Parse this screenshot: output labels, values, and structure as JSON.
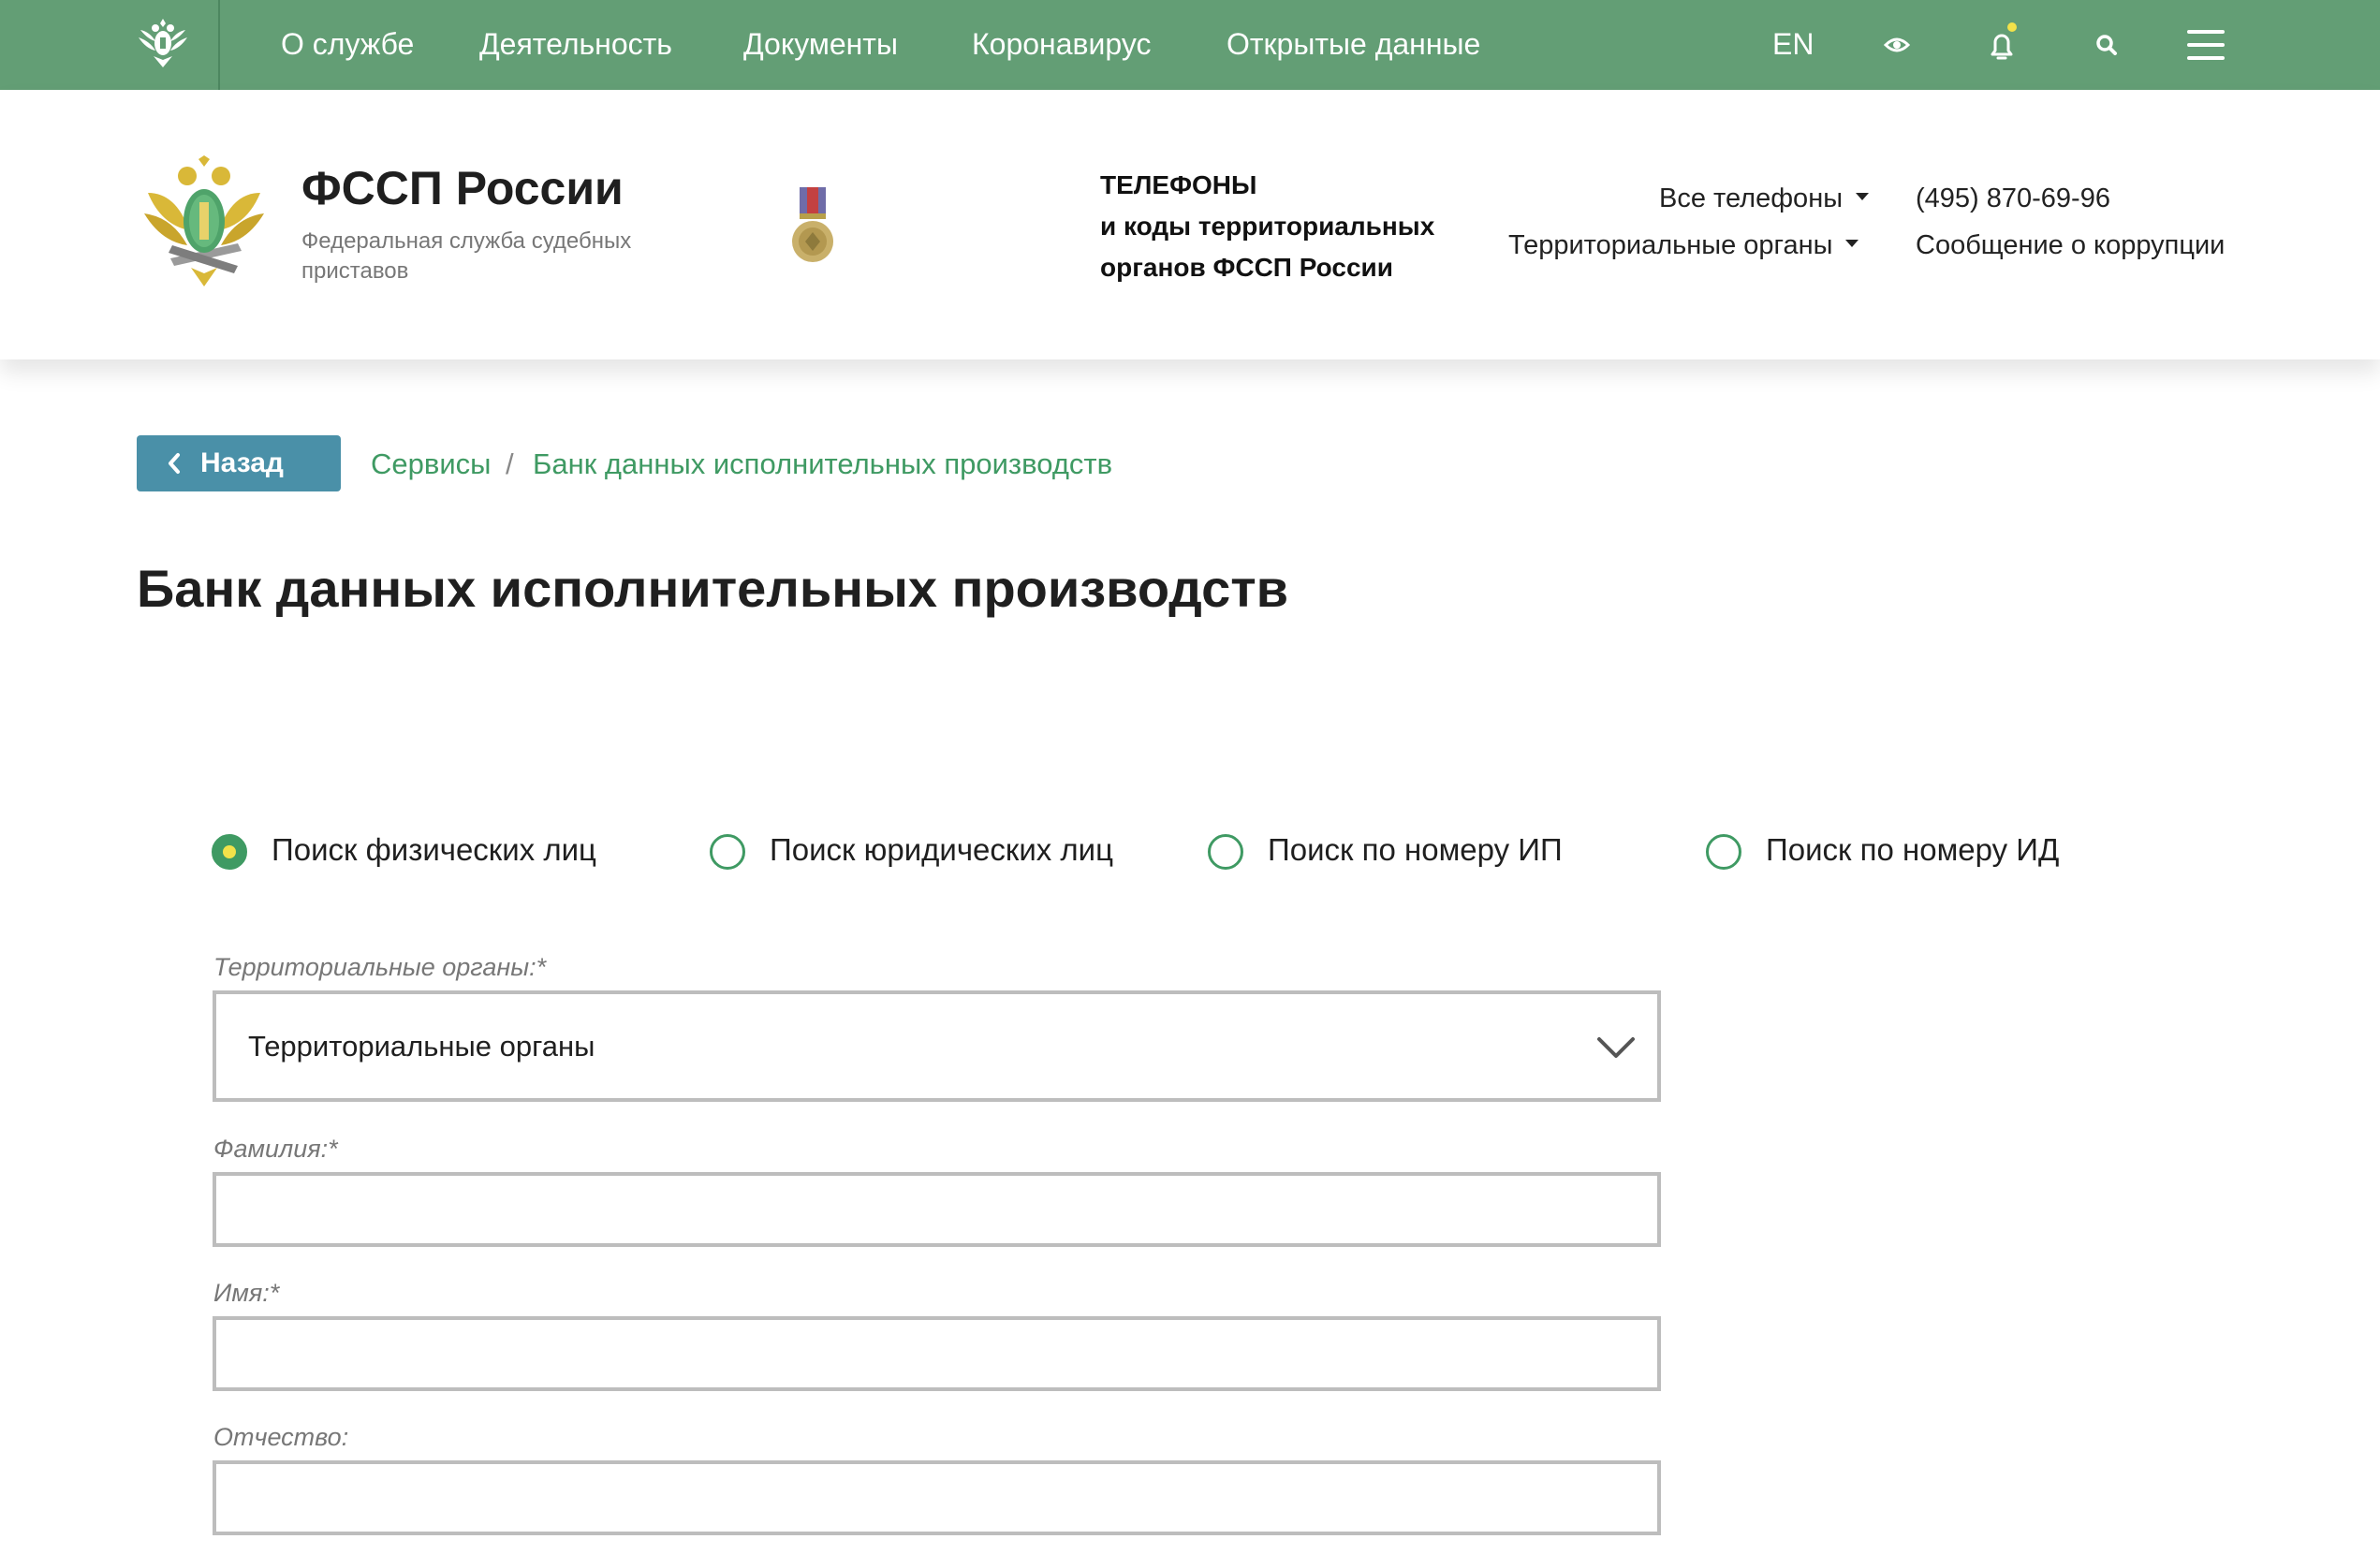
{
  "topbar": {
    "nav": [
      {
        "label": "О службе"
      },
      {
        "label": "Деятельность"
      },
      {
        "label": "Документы"
      },
      {
        "label": "Коронавирус"
      },
      {
        "label": "Открытые данные"
      }
    ],
    "lang": "EN",
    "icons": [
      "eye-icon",
      "bell-icon",
      "search-icon",
      "menu-icon"
    ],
    "notification_dot_color": "#f2e24a",
    "bg_color": "#639e75"
  },
  "header": {
    "brand_name": "ФССП России",
    "brand_sub": "Федеральная служба судебных приставов",
    "phones_line1": "ТЕЛЕФОНЫ",
    "phones_line2": "и коды территориальных",
    "phones_line3": "органов ФССП России",
    "all_phones": "Все телефоны",
    "territorial": "Территориальные органы",
    "phone": "(495) 870-69-96",
    "corruption": "Сообщение о коррупции"
  },
  "content": {
    "back_label": "Назад",
    "breadcrumb": [
      "Сервисы",
      "Банк данных исполнительных производств"
    ],
    "breadcrumb_sep": "/",
    "title": "Банк данных исполнительных производств",
    "search_modes": [
      {
        "label": "Поиск физических лиц",
        "checked": true
      },
      {
        "label": "Поиск юридических лиц",
        "checked": false
      },
      {
        "label": "Поиск по номеру ИП",
        "checked": false
      },
      {
        "label": "Поиск по номеру ИД",
        "checked": false
      }
    ],
    "form": {
      "territorial_label": "Территориальные органы:*",
      "territorial_value": "Территориальные органы",
      "lastname_label": "Фамилия:*",
      "lastname_value": "",
      "firstname_label": "Имя:*",
      "firstname_value": "",
      "patronymic_label": "Отчество:",
      "patronymic_value": ""
    },
    "accent_color": "#3f9a63",
    "button_color": "#4a90a8"
  }
}
